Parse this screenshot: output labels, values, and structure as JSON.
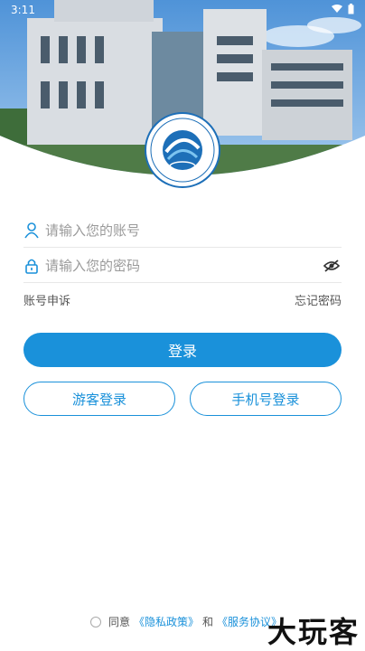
{
  "status": {
    "time": "3:11"
  },
  "form": {
    "account_placeholder": "请输入您的账号",
    "password_placeholder": "请输入您的密码",
    "appeal_label": "账号申诉",
    "forgot_label": "忘记密码",
    "login_label": "登录",
    "guest_label": "游客登录",
    "phone_label": "手机号登录"
  },
  "agreement": {
    "agree_text": "同意",
    "privacy_link": "《隐私政策》",
    "and_text": "和",
    "service_link": "《服务协议》"
  },
  "watermark": {
    "text": "大玩客"
  },
  "colors": {
    "accent": "#1a91da"
  }
}
